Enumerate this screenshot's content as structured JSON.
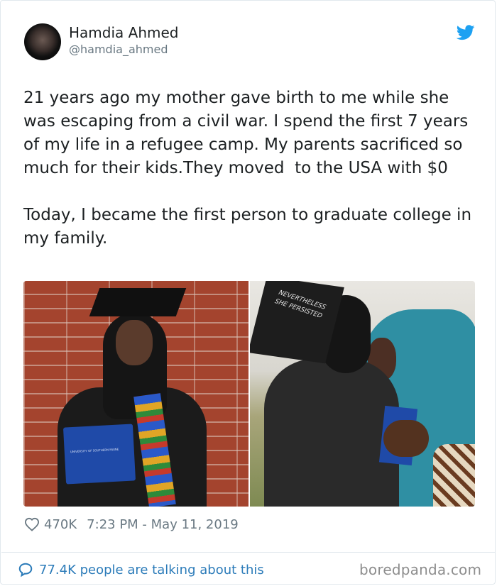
{
  "author": {
    "display_name": "Hamdia Ahmed",
    "handle": "@hamdia_ahmed"
  },
  "tweet": {
    "text": "21 years ago my mother gave birth to me while she was escaping from a civil war. I spend the first 7 years of my life in a refugee camp. My parents sacrificed so much for their kids.They moved  to the USA with $0\n\nToday, I became the first person to graduate college in my family."
  },
  "photos": {
    "left_diploma_text": "UNIVERSITY OF SOUTHERN MAINE",
    "right_cap_text": "NEVERTHELESS SHE PERSISTED"
  },
  "meta": {
    "likes": "470K",
    "timestamp": "7:23 PM - May 11, 2019"
  },
  "footer": {
    "talking_text": "77.4K people are talking about this"
  },
  "watermark": "boredpanda.com",
  "colors": {
    "text": "#1c2022",
    "secondary": "#697882",
    "link": "#2b7bb9",
    "twitter_blue": "#1da1f2",
    "border": "#e1e8ed"
  },
  "icons": {
    "brand": "twitter-bird-icon",
    "like": "heart-icon",
    "reply": "speech-bubble-icon"
  }
}
